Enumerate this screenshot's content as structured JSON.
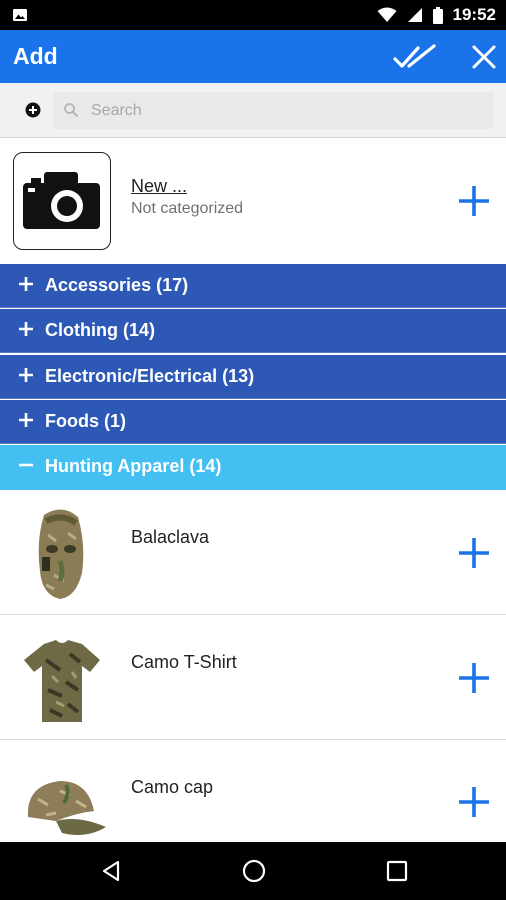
{
  "status_bar": {
    "time": "19:52",
    "icons": [
      "image-icon",
      "wifi-icon",
      "signal-icon",
      "battery-icon"
    ]
  },
  "app_bar": {
    "title": "Add",
    "actions": [
      "double-check-icon",
      "close-icon"
    ]
  },
  "search": {
    "placeholder": "Search",
    "value": ""
  },
  "new_item": {
    "name": "New ...",
    "subtitle": "Not categorized",
    "icon": "camera-icon"
  },
  "categories": [
    {
      "label": "Accessories (17)",
      "expanded": false
    },
    {
      "label": "Clothing (14)",
      "expanded": false
    },
    {
      "label": "Electronic/Electrical (13)",
      "expanded": false
    },
    {
      "label": "Foods (1)",
      "expanded": false
    },
    {
      "label": "Hunting Apparel (14)",
      "expanded": true
    }
  ],
  "products": [
    {
      "name": "Balaclava"
    },
    {
      "name": "Camo T-Shirt"
    },
    {
      "name": "Camo cap"
    }
  ],
  "colors": {
    "app_bar": "#1a73e8",
    "category": "#2d58b5",
    "category_expanded": "#44bff2",
    "plus": "#1a73e8"
  }
}
